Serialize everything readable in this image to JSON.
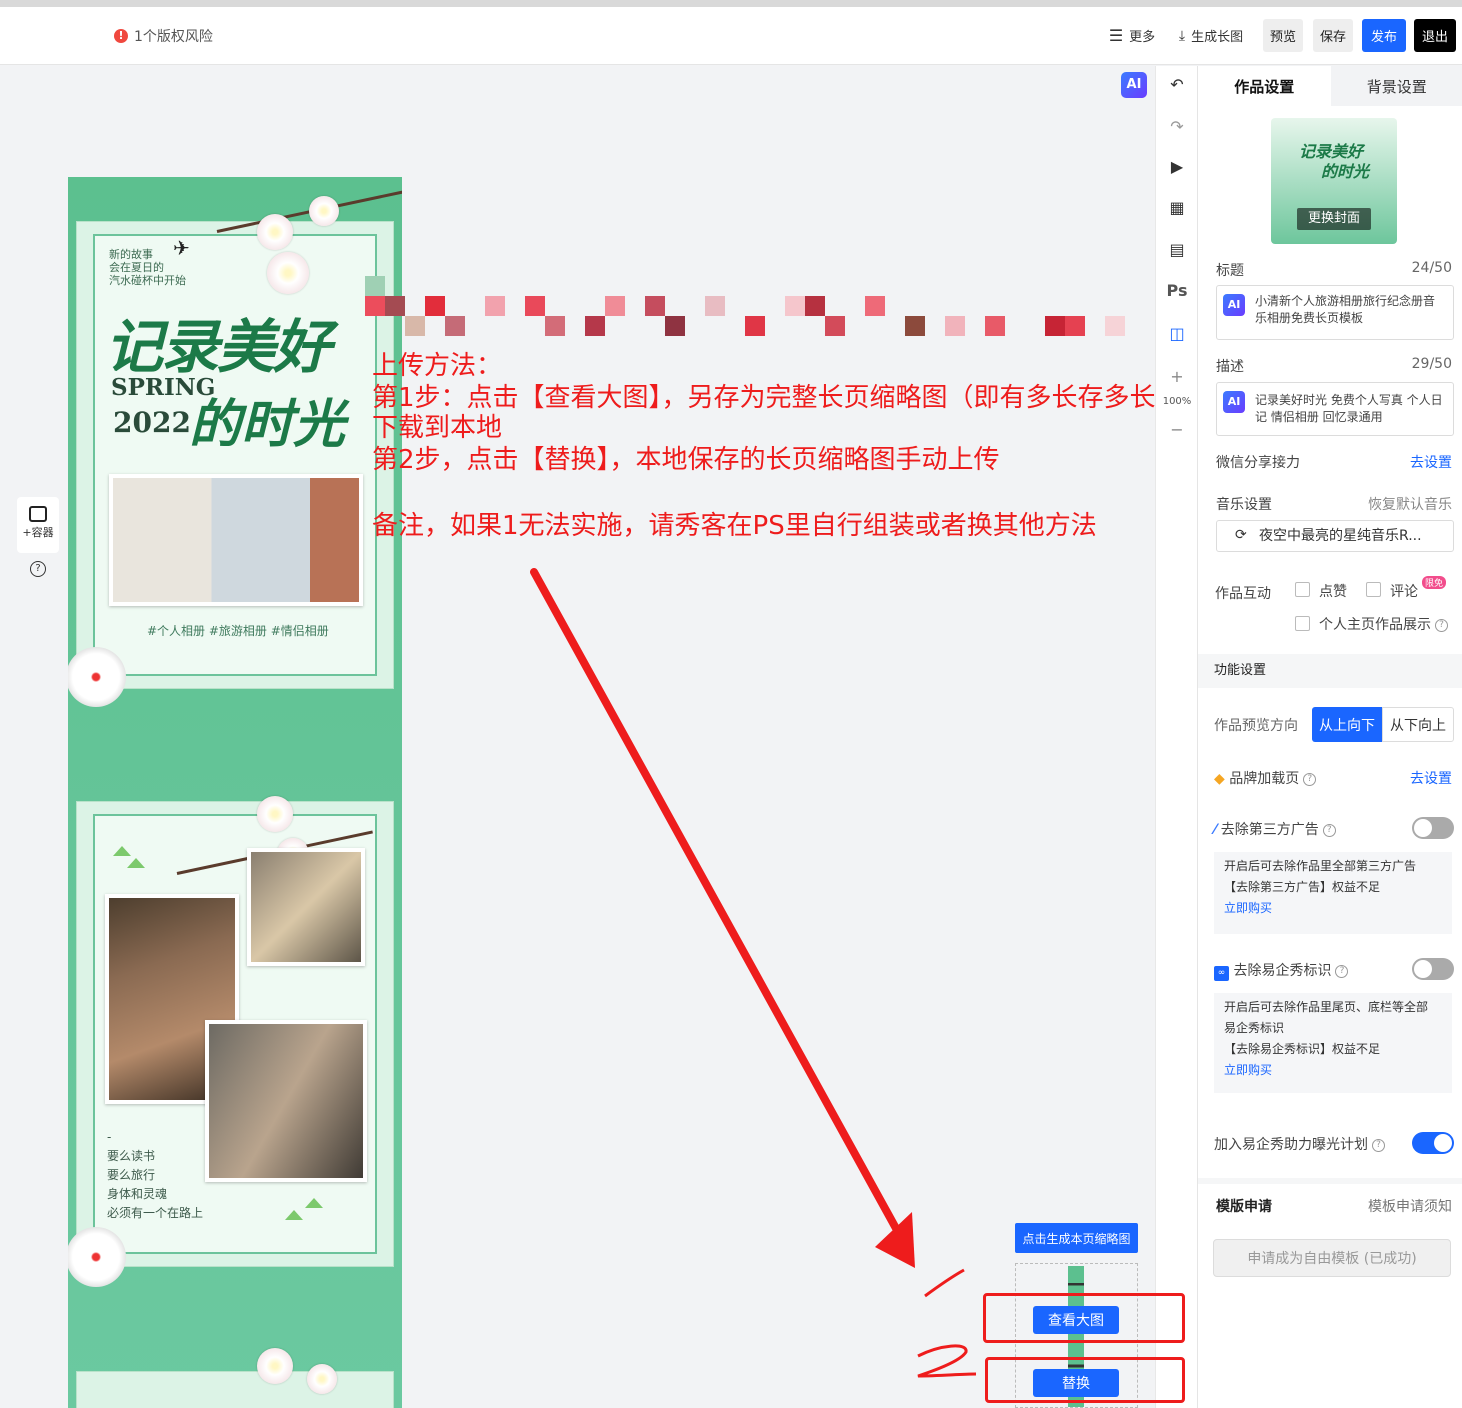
{
  "topbar": {
    "warning": "1个版权风险",
    "more": "更多",
    "long_image": "生成长图",
    "preview": "预览",
    "save": "保存",
    "publish": "发布",
    "exit": "退出"
  },
  "poster": {
    "page1": {
      "small_text": [
        "新的故事",
        "会在夏日的",
        "汽水碰杯中开始"
      ],
      "title_line1": "记录美好",
      "spring": "SPRING",
      "year": "2022",
      "title_line2": "的时光",
      "tags": "#个人相册 #旅游相册 #情侣相册"
    },
    "page2": {
      "dash": "-",
      "lines": [
        "要么读书",
        "要么旅行",
        "身体和灵魂",
        "必须有一个在路上"
      ]
    }
  },
  "annotation": {
    "line1": "上传方法：",
    "line2": "第1步：点击【查看大图】，另存为完整长页缩略图（即有多长存多长）",
    "line3": "下载到本地",
    "line4": "第2步，点击【替换】，本地保存的长页缩略图手动上传",
    "line5": "备注，如果1无法实施，请秀客在PS里自行组装或者换其他方法",
    "mark1": "1",
    "mark2": "2"
  },
  "left_tools": {
    "container": "+容器"
  },
  "canvas": {
    "ai_label": "AI",
    "zoom": "100%",
    "generate_thumb": "点击生成本页缩略图",
    "view_large": "查看大图",
    "replace": "替换"
  },
  "panel": {
    "tabs": [
      "作品设置",
      "背景设置"
    ],
    "cover_button": "更换封面",
    "cover_title_line1": "记录美好",
    "cover_title_line2": "的时光",
    "title_label": "标题",
    "title_count": "24/50",
    "title_value": "小清新个人旅游相册旅行纪念册音乐相册免费长页模板",
    "desc_label": "描述",
    "desc_count": "29/50",
    "desc_value": "记录美好时光 免费个人写真 个人日记 情侣相册 回忆录通用",
    "wechat_label": "微信分享接力",
    "wechat_link": "去设置",
    "music_label": "音乐设置",
    "music_reset": "恢复默认音乐",
    "music_value": "夜空中最亮的星纯音乐R...",
    "interaction_label": "作品互动",
    "like": "点赞",
    "comment": "评论",
    "comment_badge": "限免",
    "profile_show": "个人主页作品展示",
    "function_section": "功能设置",
    "preview_dir_label": "作品预览方向",
    "dir_top_down": "从上向下",
    "dir_bottom_up": "从下向上",
    "brand_label": "品牌加载页",
    "brand_link": "去设置",
    "remove_ads_label": "去除第三方广告",
    "remove_ads_info": [
      "开启后可去除作品里全部第三方广告",
      "【去除第三方广告】权益不足"
    ],
    "buy_now": "立即购买",
    "remove_logo_label": "去除易企秀标识",
    "remove_logo_info": [
      "开启后可去除作品里尾页、底栏等全部",
      "易企秀标识",
      "【去除易企秀标识】权益不足"
    ],
    "exposure_label": "加入易企秀助力曝光计划",
    "template_label": "模版申请",
    "template_notice": "模板申请须知",
    "apply_button": "申请成为自由模板 (已成功)"
  },
  "colors": {
    "accent": "#1a66ff",
    "annotation": "#ee1c1c",
    "poster_green": "#5cc08f"
  }
}
